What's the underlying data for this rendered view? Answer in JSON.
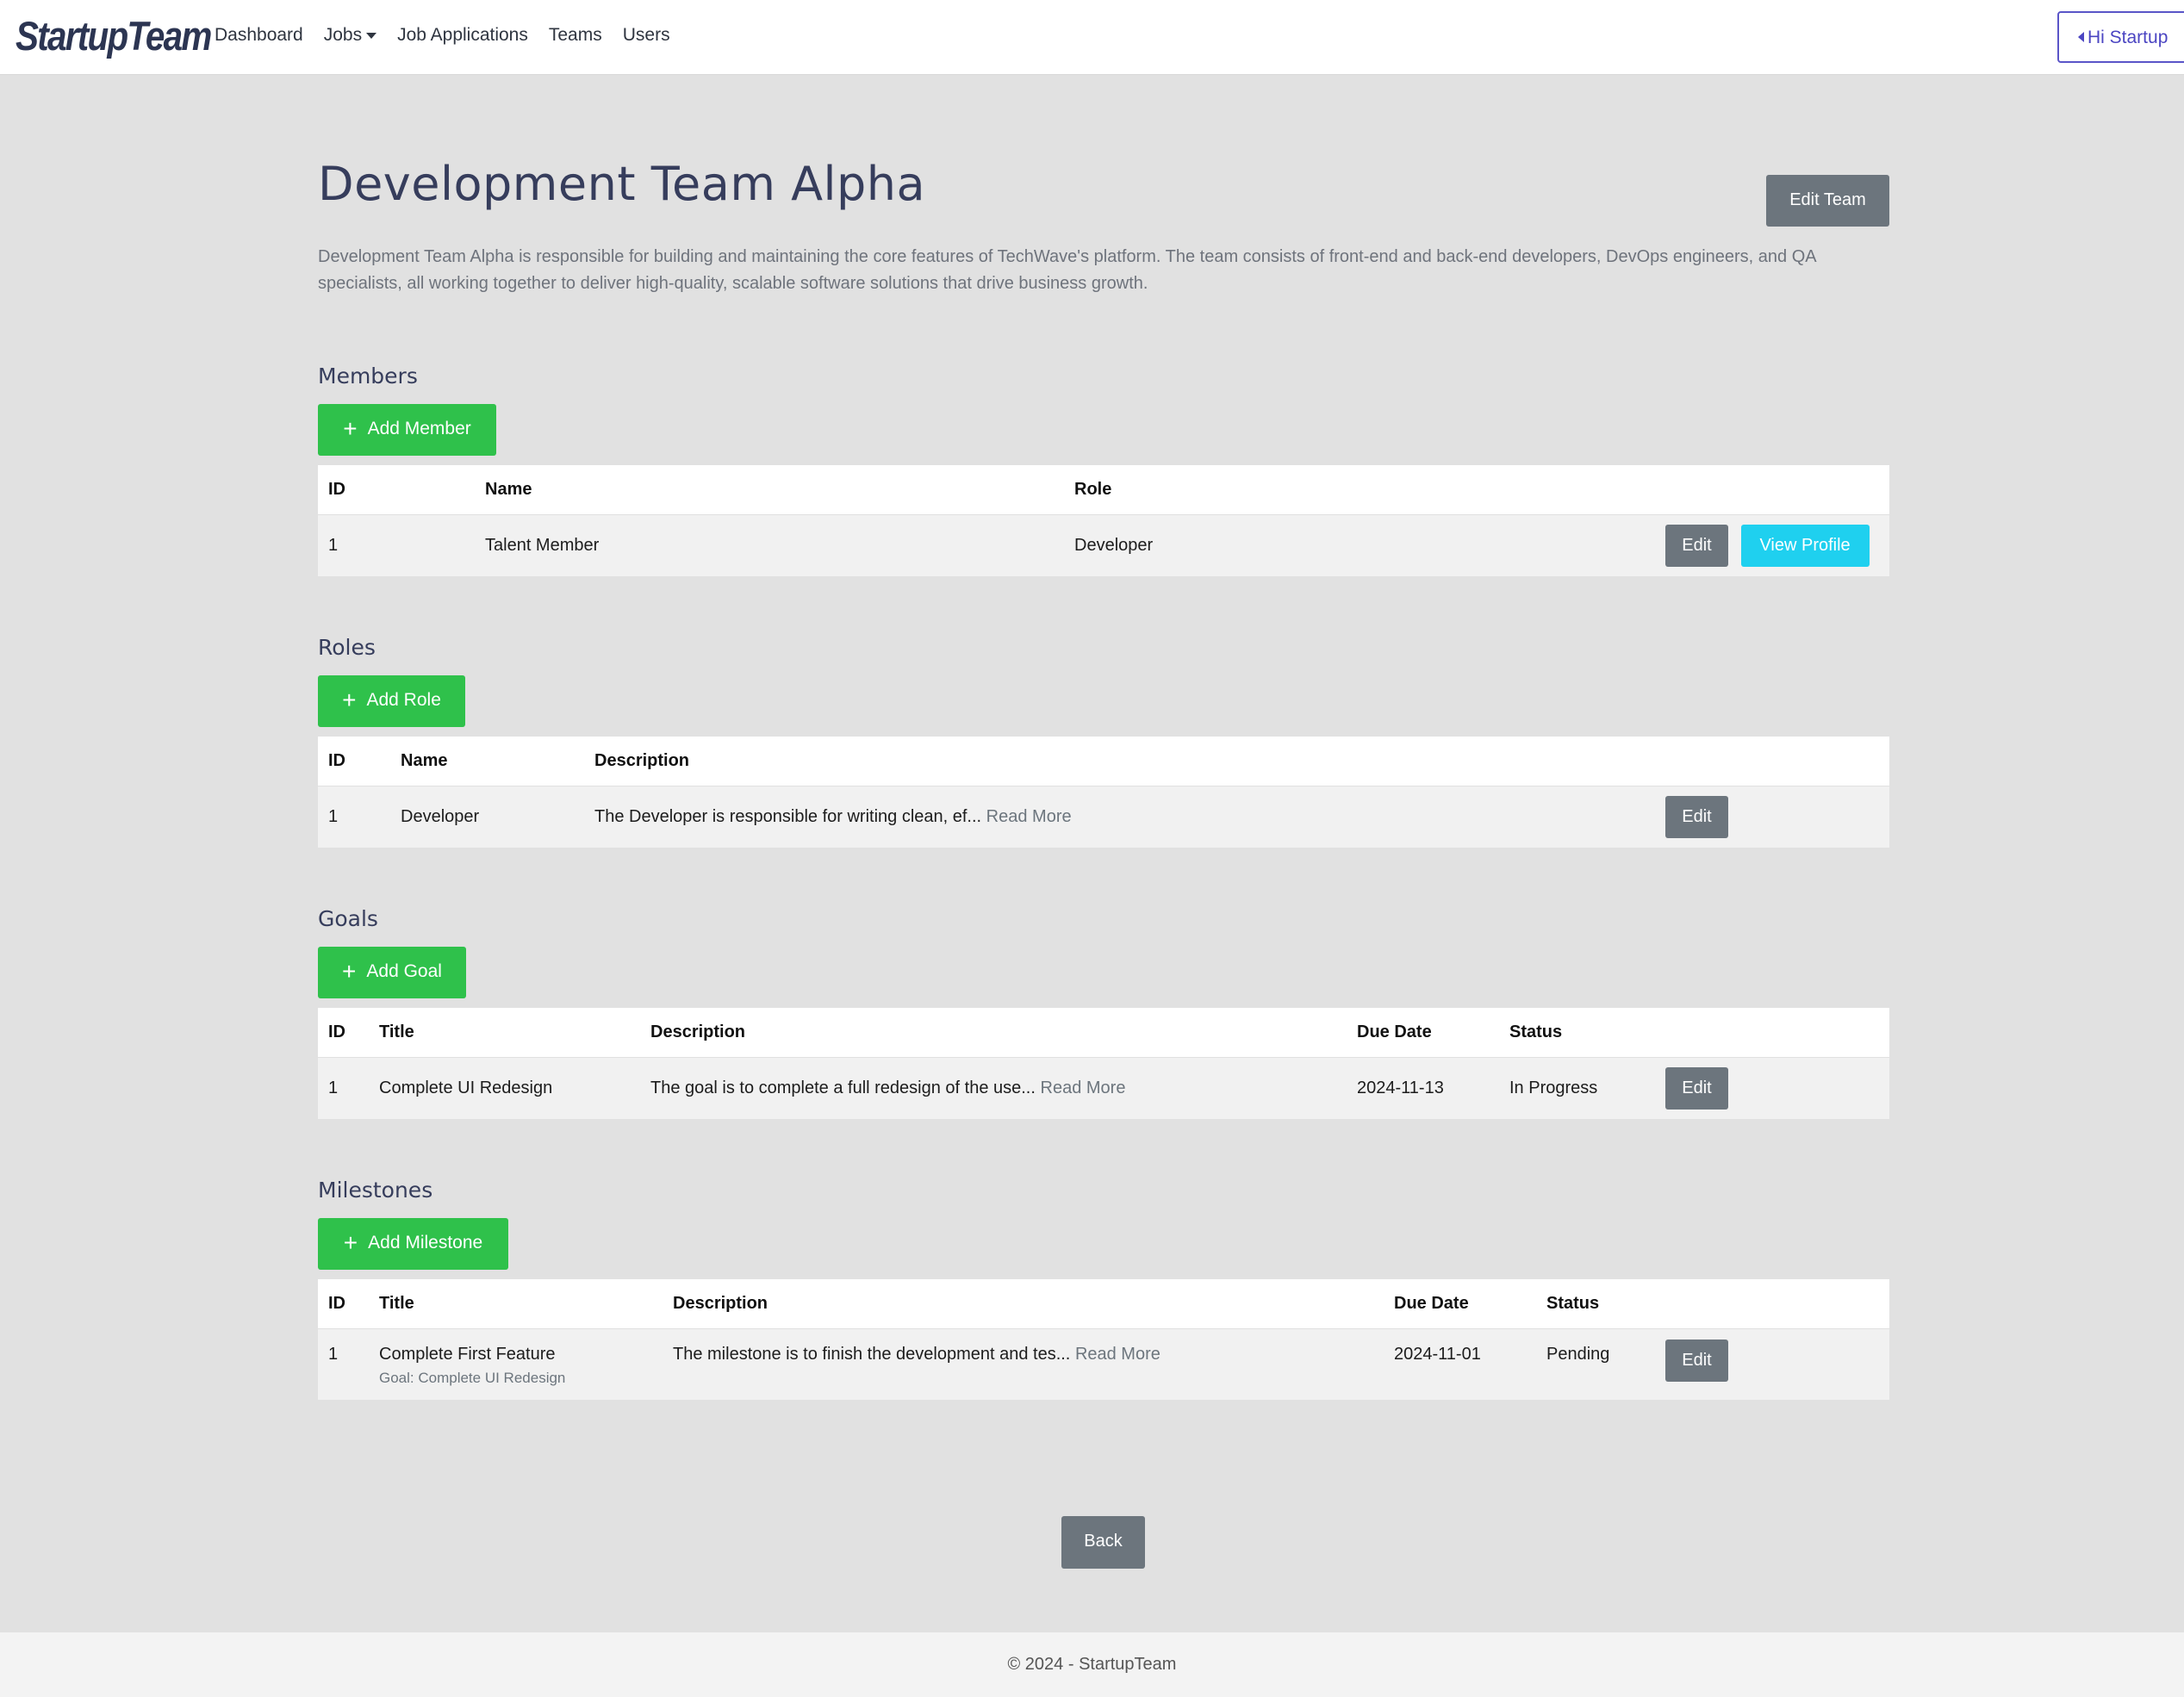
{
  "nav": {
    "brand": "StartupTeam",
    "links": [
      "Dashboard",
      "Jobs",
      "Job Applications",
      "Teams",
      "Users"
    ],
    "user_button": "Hi Startup"
  },
  "page": {
    "title": "Development Team Alpha",
    "edit_team": "Edit Team",
    "description": "Development Team Alpha is responsible for building and maintaining the core features of TechWave's platform. The team consists of front-end and back-end developers, DevOps engineers, and QA specialists, all working together to deliver high-quality, scalable software solutions that drive business growth."
  },
  "members": {
    "title": "Members",
    "add_label": "Add Member",
    "headers": [
      "ID",
      "Name",
      "Role"
    ],
    "rows": [
      {
        "id": "1",
        "name": "Talent Member",
        "role": "Developer",
        "edit": "Edit",
        "view": "View Profile"
      }
    ]
  },
  "roles": {
    "title": "Roles",
    "add_label": "Add Role",
    "headers": [
      "ID",
      "Name",
      "Description"
    ],
    "rows": [
      {
        "id": "1",
        "name": "Developer",
        "description": "The Developer is responsible for writing clean, ef...",
        "read_more": "Read More",
        "edit": "Edit"
      }
    ]
  },
  "goals": {
    "title": "Goals",
    "add_label": "Add Goal",
    "headers": [
      "ID",
      "Title",
      "Description",
      "Due Date",
      "Status"
    ],
    "rows": [
      {
        "id": "1",
        "title": "Complete UI Redesign",
        "description": "The goal is to complete a full redesign of the use...",
        "read_more": "Read More",
        "due": "2024-11-13",
        "status": "In Progress",
        "edit": "Edit"
      }
    ]
  },
  "milestones": {
    "title": "Milestones",
    "add_label": "Add Milestone",
    "headers": [
      "ID",
      "Title",
      "Description",
      "Due Date",
      "Status"
    ],
    "rows": [
      {
        "id": "1",
        "title": "Complete First Feature",
        "goal_note": "Goal: Complete UI Redesign",
        "description": "The milestone is to finish the development and tes...",
        "read_more": "Read More",
        "due": "2024-11-01",
        "status": "Pending",
        "edit": "Edit"
      }
    ]
  },
  "back_label": "Back",
  "footer": "© 2024 - StartupTeam",
  "colors": {
    "primary_green": "#2fc14b",
    "secondary_gray": "#6c757d",
    "info_cyan": "#1fd0ef",
    "heading": "#363d5c",
    "user_button": "#4b45c2"
  }
}
